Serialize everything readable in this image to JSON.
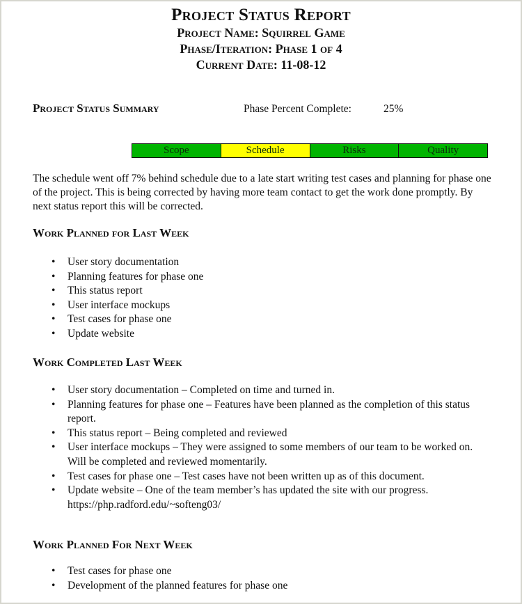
{
  "header": {
    "title": "Project Status Report",
    "project_name": "Project Name: Squirrel Game",
    "phase": "Phase/Iteration: Phase 1 of 4",
    "current_date": "Current Date: 11-08-12"
  },
  "summary": {
    "heading": "Project Status Summary",
    "percent_label": "Phase Percent Complete:",
    "percent_value": "25%",
    "status_cells": [
      {
        "label": "Scope",
        "color": "#00b400"
      },
      {
        "label": "Schedule",
        "color": "#ffff00"
      },
      {
        "label": "Risks",
        "color": "#00b400"
      },
      {
        "label": "Quality",
        "color": "#00b400"
      }
    ],
    "description": "The schedule went off 7% behind schedule due to a late start writing test cases and planning for phase one of the project. This is being corrected by having more team contact to get the work done promptly. By next status report this will be corrected."
  },
  "planned_last_week": {
    "heading": "Work Planned for Last Week",
    "items": [
      "User story documentation",
      "Planning features for phase one",
      "This status report",
      "User interface mockups",
      "Test cases for phase one",
      "Update website"
    ]
  },
  "completed_last_week": {
    "heading": "Work Completed Last Week",
    "items": [
      "User story documentation – Completed on time and turned in.",
      "Planning features for phase one – Features have been planned as the completion of this status report.",
      "This status report – Being completed and reviewed",
      "User interface mockups – They were assigned to some members of our team to be worked on. Will be completed and reviewed momentarily.",
      "Test cases for phase one – Test cases have not been written up as of this document.",
      "Update website – One of the team member’s has updated the site with our progress. https://php.radford.edu/~softeng03/"
    ]
  },
  "planned_next_week": {
    "heading": "Work Planned For Next Week",
    "items": [
      "Test cases for phase one",
      "Development of the planned features for phase one"
    ]
  },
  "bullet_glyph": "•"
}
